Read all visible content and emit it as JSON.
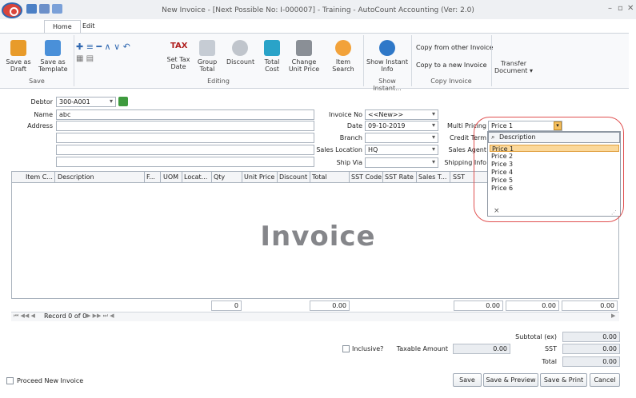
{
  "window": {
    "title": "New Invoice - [Next Possible No: I-000007] - Training - AutoCount Accounting (Ver: 2.0)"
  },
  "tabs": [
    "Home",
    "Edit"
  ],
  "ribbon": {
    "save_draft": "Save as Draft",
    "save_template": "Save as Template",
    "group_save": "Save",
    "set_tax": "Set Tax Date",
    "group_total": "Group Total",
    "discount": "Discount",
    "total_cost": "Total Cost",
    "change_unit_price": "Change Unit Price",
    "item_search": "Item Search",
    "group_editing": "Editing",
    "show_instant": "Show Instant Info",
    "group_show_instant": "Show Instant...",
    "copy_from": "Copy from other Invoice",
    "copy_to": "Copy to a new Invoice",
    "group_copy": "Copy Invoice",
    "transfer": "Transfer Document ▾",
    "tax_icon_text": "TAX"
  },
  "form": {
    "debtor_label": "Debtor",
    "debtor_value": "300-A001",
    "name_label": "Name",
    "name_value": "abc",
    "address_label": "Address",
    "invoice_no_label": "Invoice No",
    "invoice_no_value": "<<New>>",
    "date_label": "Date",
    "date_value": "09-10-2019",
    "branch_label": "Branch",
    "sales_location_label": "Sales Location",
    "sales_location_value": "HQ",
    "ship_via_label": "Ship Via",
    "multi_pricing_label": "Multi Pricing",
    "multi_pricing_value": "Price 1",
    "credit_term_label": "Credit Term",
    "sales_agent_label": "Sales Agent",
    "shipping_info_label": "Shipping Info"
  },
  "dropdown": {
    "header": "Description",
    "options": [
      "Price 1",
      "Price 2",
      "Price 3",
      "Price 4",
      "Price 5",
      "Price 6"
    ],
    "close": "×"
  },
  "grid": {
    "columns": [
      "Item C...",
      "Description",
      "F...",
      "UOM",
      "Locat...",
      "Qty",
      "Unit Price",
      "Discount",
      "Total",
      "SST Code",
      "SST Rate",
      "Sales T...",
      "SST"
    ],
    "watermark": "Invoice",
    "qty_total": "0",
    "total_sum": "0.00",
    "sst_total_1": "0.00",
    "sst_total_2": "0.00",
    "sst_total_3": "0.00",
    "record": "Record 0 of 0"
  },
  "footer": {
    "subtotal_label": "Subtotal (ex)",
    "subtotal_value": "0.00",
    "inclusive_label": "Inclusive?",
    "taxable_label": "Taxable Amount",
    "taxable_value": "0.00",
    "sst_label": "SST",
    "sst_value": "0.00",
    "total_label": "Total",
    "total_value": "0.00",
    "proceed_label": "Proceed New Invoice",
    "save": "Save",
    "save_preview": "Save & Preview",
    "save_print": "Save & Print",
    "cancel": "Cancel"
  }
}
